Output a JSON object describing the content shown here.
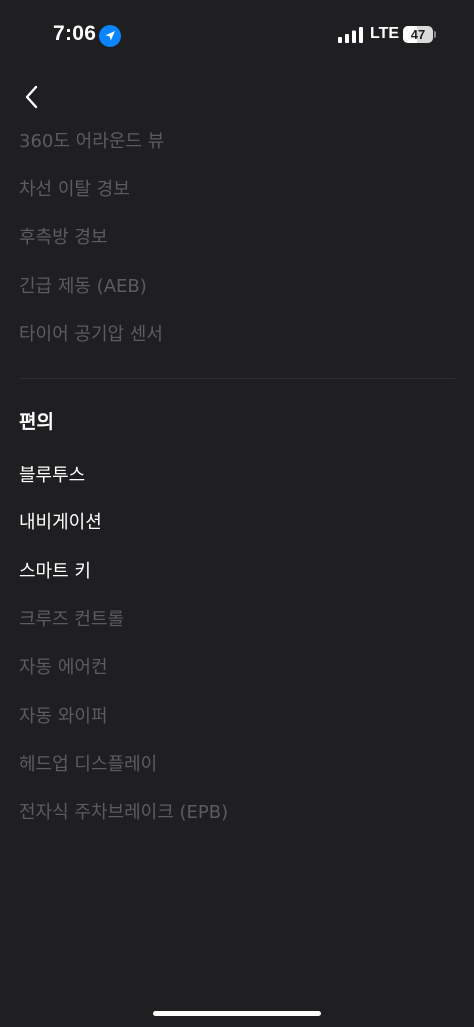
{
  "status_bar": {
    "time": "7:06",
    "network": "LTE",
    "battery_level": "47",
    "battery_fraction": 0.47,
    "location_icon": "location-arrow-icon",
    "signal_icon": "cellular-signal-icon",
    "accent_color": "#0a84ff"
  },
  "nav": {
    "back_icon": "chevron-left-icon"
  },
  "safety_items": [
    {
      "label": "360도 어라운드 뷰",
      "enabled": false
    },
    {
      "label": "차선 이탈 경보",
      "enabled": false
    },
    {
      "label": "후측방 경보",
      "enabled": false
    },
    {
      "label": "긴급 제동 (AEB)",
      "enabled": false
    },
    {
      "label": "타이어 공기압 센서",
      "enabled": false
    }
  ],
  "convenience": {
    "heading": "편의",
    "items": [
      {
        "label": "블루투스",
        "enabled": true
      },
      {
        "label": "내비게이션",
        "enabled": true
      },
      {
        "label": "스마트 키",
        "enabled": true
      },
      {
        "label": "크루즈 컨트롤",
        "enabled": false
      },
      {
        "label": "자동 에어컨",
        "enabled": false
      },
      {
        "label": "자동 와이퍼",
        "enabled": false
      },
      {
        "label": "헤드업 디스플레이",
        "enabled": false
      },
      {
        "label": "전자식 주차브레이크 (EPB)",
        "enabled": false
      }
    ]
  },
  "colors": {
    "background": "#1f1f21",
    "enabled_text": "#ffffff",
    "disabled_text": "#5c5c60"
  }
}
